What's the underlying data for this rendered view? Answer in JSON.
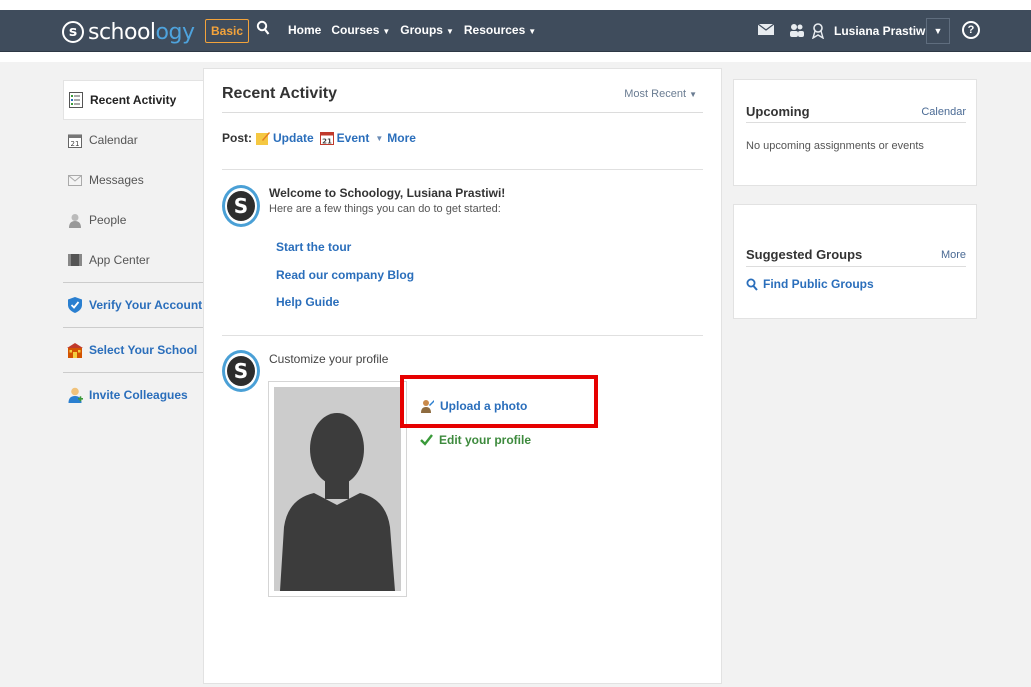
{
  "nav": {
    "logo_prefix": "school",
    "logo_suffix": "ogy",
    "logo_circle": "s",
    "basic": "Basic",
    "items": [
      {
        "label": "Home",
        "caret": ""
      },
      {
        "label": "Courses",
        "caret": "▼"
      },
      {
        "label": "Groups",
        "caret": "▼"
      },
      {
        "label": "Resources",
        "caret": "▼"
      }
    ],
    "user_name": "Lusiana Prastiwi",
    "dropdown_caret": "▼",
    "help": "?",
    "search_icon": "search-icon"
  },
  "sidebar": {
    "items": [
      {
        "label": "Recent Activity",
        "icon": "recent-activity-icon"
      },
      {
        "label": "Calendar",
        "icon": "calendar-icon"
      },
      {
        "label": "Messages",
        "icon": "messages-icon"
      },
      {
        "label": "People",
        "icon": "people-icon"
      },
      {
        "label": "App Center",
        "icon": "app-center-icon"
      },
      {
        "label": "Verify Your Account",
        "icon": "verify-icon"
      },
      {
        "label": "Select Your School",
        "icon": "school-icon"
      },
      {
        "label": "Invite Colleagues",
        "icon": "invite-icon"
      }
    ]
  },
  "main": {
    "title": "Recent Activity",
    "sort": "Most Recent",
    "sort_caret": "▼",
    "post_label": "Post:",
    "post_update": "Update",
    "post_event": "Event",
    "post_more": "More",
    "post_more_caret": "▼",
    "welcome_title": "Welcome to Schoology, Lusiana Prastiwi!",
    "welcome_sub": "Here are a few things you can do to get started:",
    "links": [
      "Start the tour",
      "Read our company Blog",
      "Help Guide"
    ],
    "customize": "Customize your profile",
    "upload": "Upload a photo",
    "edit": "Edit your profile",
    "avatar_letter": "S"
  },
  "upcoming": {
    "title": "Upcoming",
    "link": "Calendar",
    "empty": "No upcoming assignments or events"
  },
  "groups": {
    "title": "Suggested Groups",
    "link": "More",
    "find": "Find Public Groups"
  },
  "colors": {
    "navbar": "#3f4c5c",
    "link": "#2a6ebb",
    "accent": "#f3a33b",
    "highlight": "#e60000"
  }
}
